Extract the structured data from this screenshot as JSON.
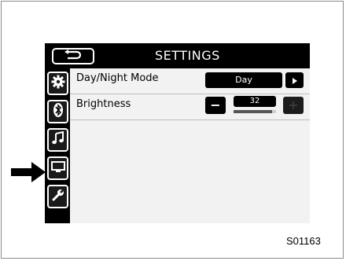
{
  "header": {
    "title": "SETTINGS",
    "back_icon": "back-arrow-icon"
  },
  "sidebar": {
    "items": [
      {
        "name": "general",
        "icon": "gear-icon"
      },
      {
        "name": "bluetooth",
        "icon": "bluetooth-icon"
      },
      {
        "name": "audio",
        "icon": "music-note-icon"
      },
      {
        "name": "screen",
        "icon": "screen-icon",
        "indicated": true
      },
      {
        "name": "tools",
        "icon": "wrench-icon"
      }
    ]
  },
  "rows": {
    "day_night": {
      "label": "Day/Night Mode",
      "value": "Day",
      "arrow_icon": "play-right-icon"
    },
    "brightness": {
      "label": "Brightness",
      "value": "32",
      "minus_label": "−",
      "plus_label": "+",
      "level_fraction": 0.9
    }
  },
  "figure_code": "S01163",
  "colors": {
    "screen_bg": "#000000",
    "content_bg": "#f2f2f2",
    "disabled_button": "#1c1c1c"
  }
}
